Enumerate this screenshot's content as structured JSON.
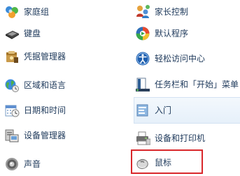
{
  "control_panel": {
    "left_column": [
      {
        "label": "家庭组",
        "icon": "homegroup-icon"
      },
      {
        "label": "键盘",
        "icon": "keyboard-icon"
      },
      {
        "label": "凭据管理器",
        "icon": "credential-manager-icon"
      },
      {
        "label": "区域和语言",
        "icon": "region-language-icon"
      },
      {
        "label": "日期和时间",
        "icon": "calendar-clock-icon"
      },
      {
        "label": "设备管理器",
        "icon": "device-manager-icon"
      },
      {
        "label": "声音",
        "icon": "speaker-icon"
      }
    ],
    "right_column": [
      {
        "label": "家长控制",
        "icon": "parental-controls-icon"
      },
      {
        "label": "默认程序",
        "icon": "default-programs-icon"
      },
      {
        "label": "轻松访问中心",
        "icon": "ease-of-access-icon"
      },
      {
        "label": "任务栏和「开始」菜单",
        "icon": "taskbar-start-menu-icon"
      },
      {
        "label": "入门",
        "icon": "getting-started-icon"
      },
      {
        "label": "设备和打印机",
        "icon": "printer-icon"
      },
      {
        "label": "鼠标",
        "icon": "mouse-icon"
      }
    ],
    "highlight_color": "#d9272b",
    "link_color": "#1e395b"
  }
}
